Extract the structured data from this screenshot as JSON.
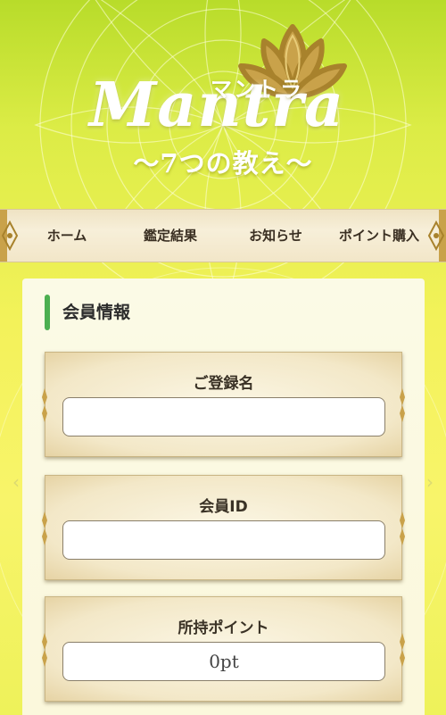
{
  "header": {
    "logo_wordmark": "Mantra",
    "logo_katakana": "マントラ",
    "logo_subtitle": "〜7つの教え〜"
  },
  "nav": {
    "items": [
      {
        "label": "ホーム"
      },
      {
        "label": "鑑定結果"
      },
      {
        "label": "お知らせ"
      },
      {
        "label": "ポイント購入"
      }
    ]
  },
  "member": {
    "section_title": "会員情報",
    "fields": [
      {
        "label": "ご登録名",
        "value": ""
      },
      {
        "label": "会員ID",
        "value": ""
      },
      {
        "label": "所持ポイント",
        "value": "0pt"
      }
    ]
  },
  "colors": {
    "accent_green": "#4caf50",
    "gold": "#c9a24a",
    "background_yellow": "#f3f25a"
  }
}
